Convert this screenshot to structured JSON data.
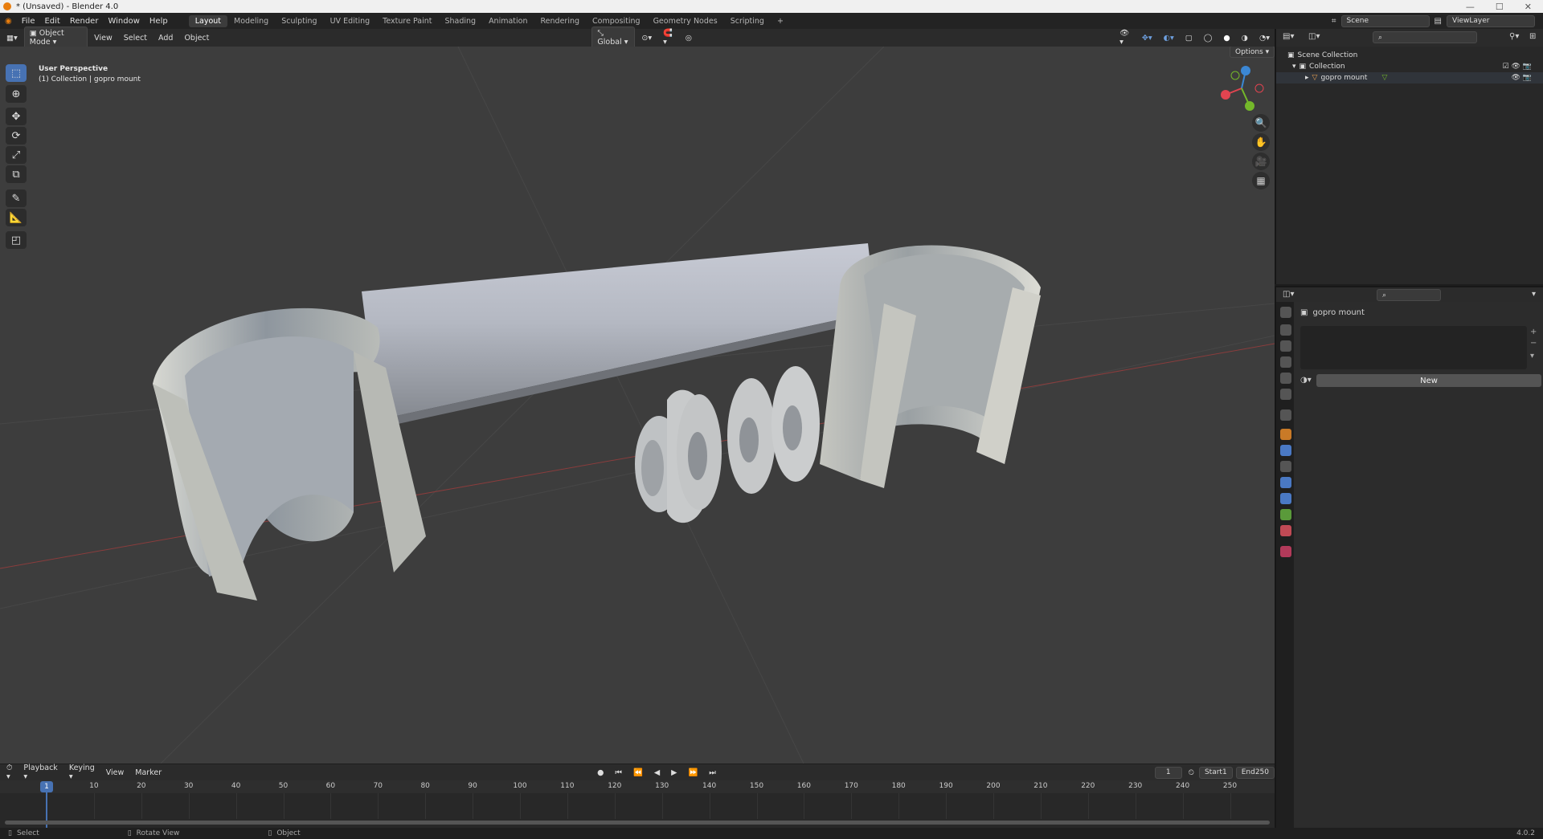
{
  "window": {
    "title": "* (Unsaved) - Blender 4.0"
  },
  "menu": [
    "File",
    "Edit",
    "Render",
    "Window",
    "Help"
  ],
  "workspaces": [
    "Layout",
    "Modeling",
    "Sculpting",
    "UV Editing",
    "Texture Paint",
    "Shading",
    "Animation",
    "Rendering",
    "Compositing",
    "Geometry Nodes",
    "Scripting"
  ],
  "active_workspace": "Layout",
  "topright": {
    "scene": "Scene",
    "view_layer": "ViewLayer"
  },
  "viewport": {
    "mode": "Object Mode",
    "menus": [
      "View",
      "Select",
      "Add",
      "Object"
    ],
    "orientation": "Global",
    "options": "Options",
    "overlay_line1": "User Perspective",
    "overlay_line2": "(1) Collection | gopro mount"
  },
  "outliner": {
    "root": "Scene Collection",
    "collection": "Collection",
    "object": "gopro mount"
  },
  "properties": {
    "object": "gopro mount",
    "new_button": "New"
  },
  "timeline": {
    "menus": [
      "Playback",
      "Keying",
      "View",
      "Marker"
    ],
    "current_frame": "1",
    "start_label": "Start",
    "start": "1",
    "end_label": "End",
    "end": "250",
    "ticks": [
      "10",
      "20",
      "30",
      "40",
      "50",
      "60",
      "70",
      "80",
      "90",
      "100",
      "110",
      "120",
      "130",
      "140",
      "150",
      "160",
      "170",
      "180",
      "190",
      "200",
      "210",
      "220",
      "230",
      "240",
      "250"
    ]
  },
  "status": {
    "select": "Select",
    "rotate": "Rotate View",
    "object": "Object",
    "version": "4.0.2"
  },
  "colors": {
    "accent": "#4772b3",
    "brand": "#e87d0d",
    "axis_x": "#e14450",
    "axis_y": "#74b82a",
    "axis_z": "#3b87d4"
  }
}
